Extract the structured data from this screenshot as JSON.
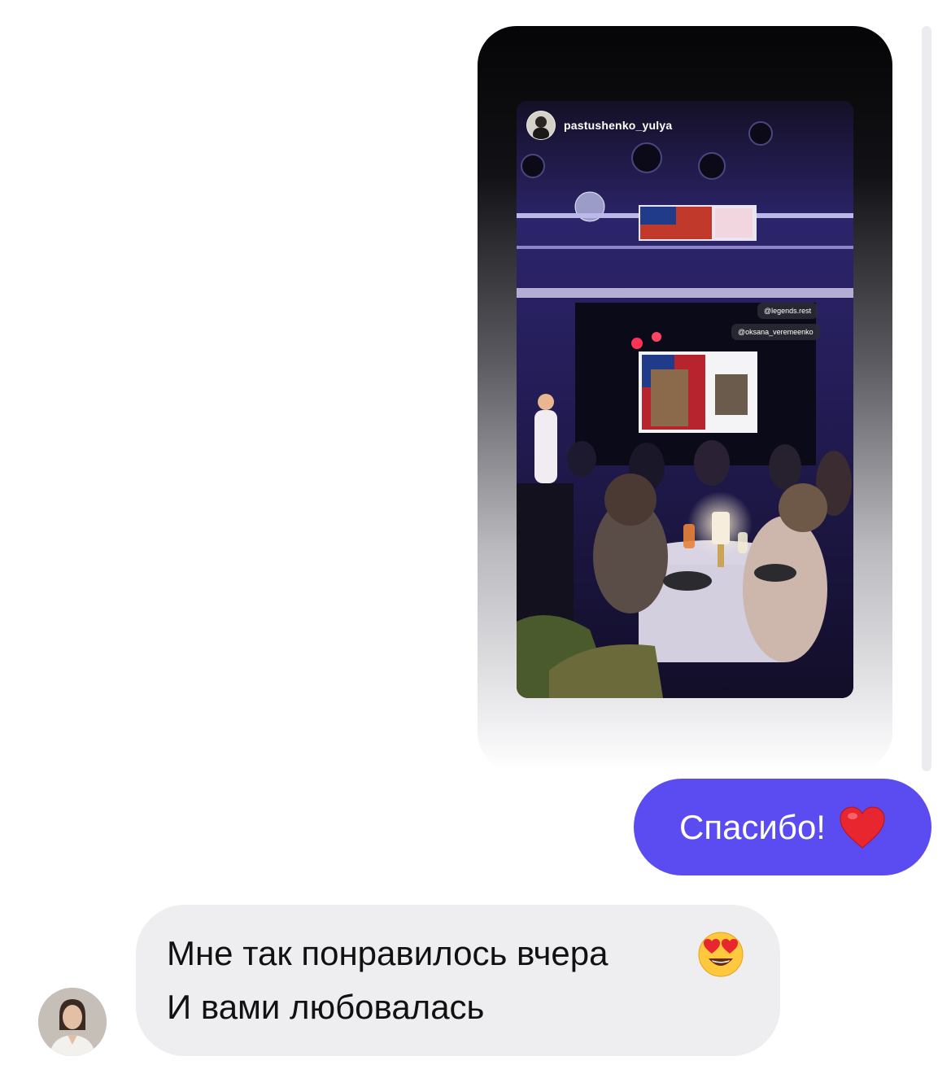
{
  "shared_story": {
    "username": "pastushenko_yulya",
    "mentions": [
      "@legends.rest",
      "@oksana_veremeenko"
    ]
  },
  "messages": {
    "outgoing_text": "Спасибо!",
    "outgoing_emoji": "heart-icon",
    "incoming_line_1": "Мне так понравилось вчера",
    "incoming_line_2": "И вами любовалась",
    "incoming_emoji": "heart-eyes-emoji-icon"
  },
  "colors": {
    "outgoing_bubble": "#5a4cf0",
    "incoming_bubble": "#eeeef1"
  }
}
